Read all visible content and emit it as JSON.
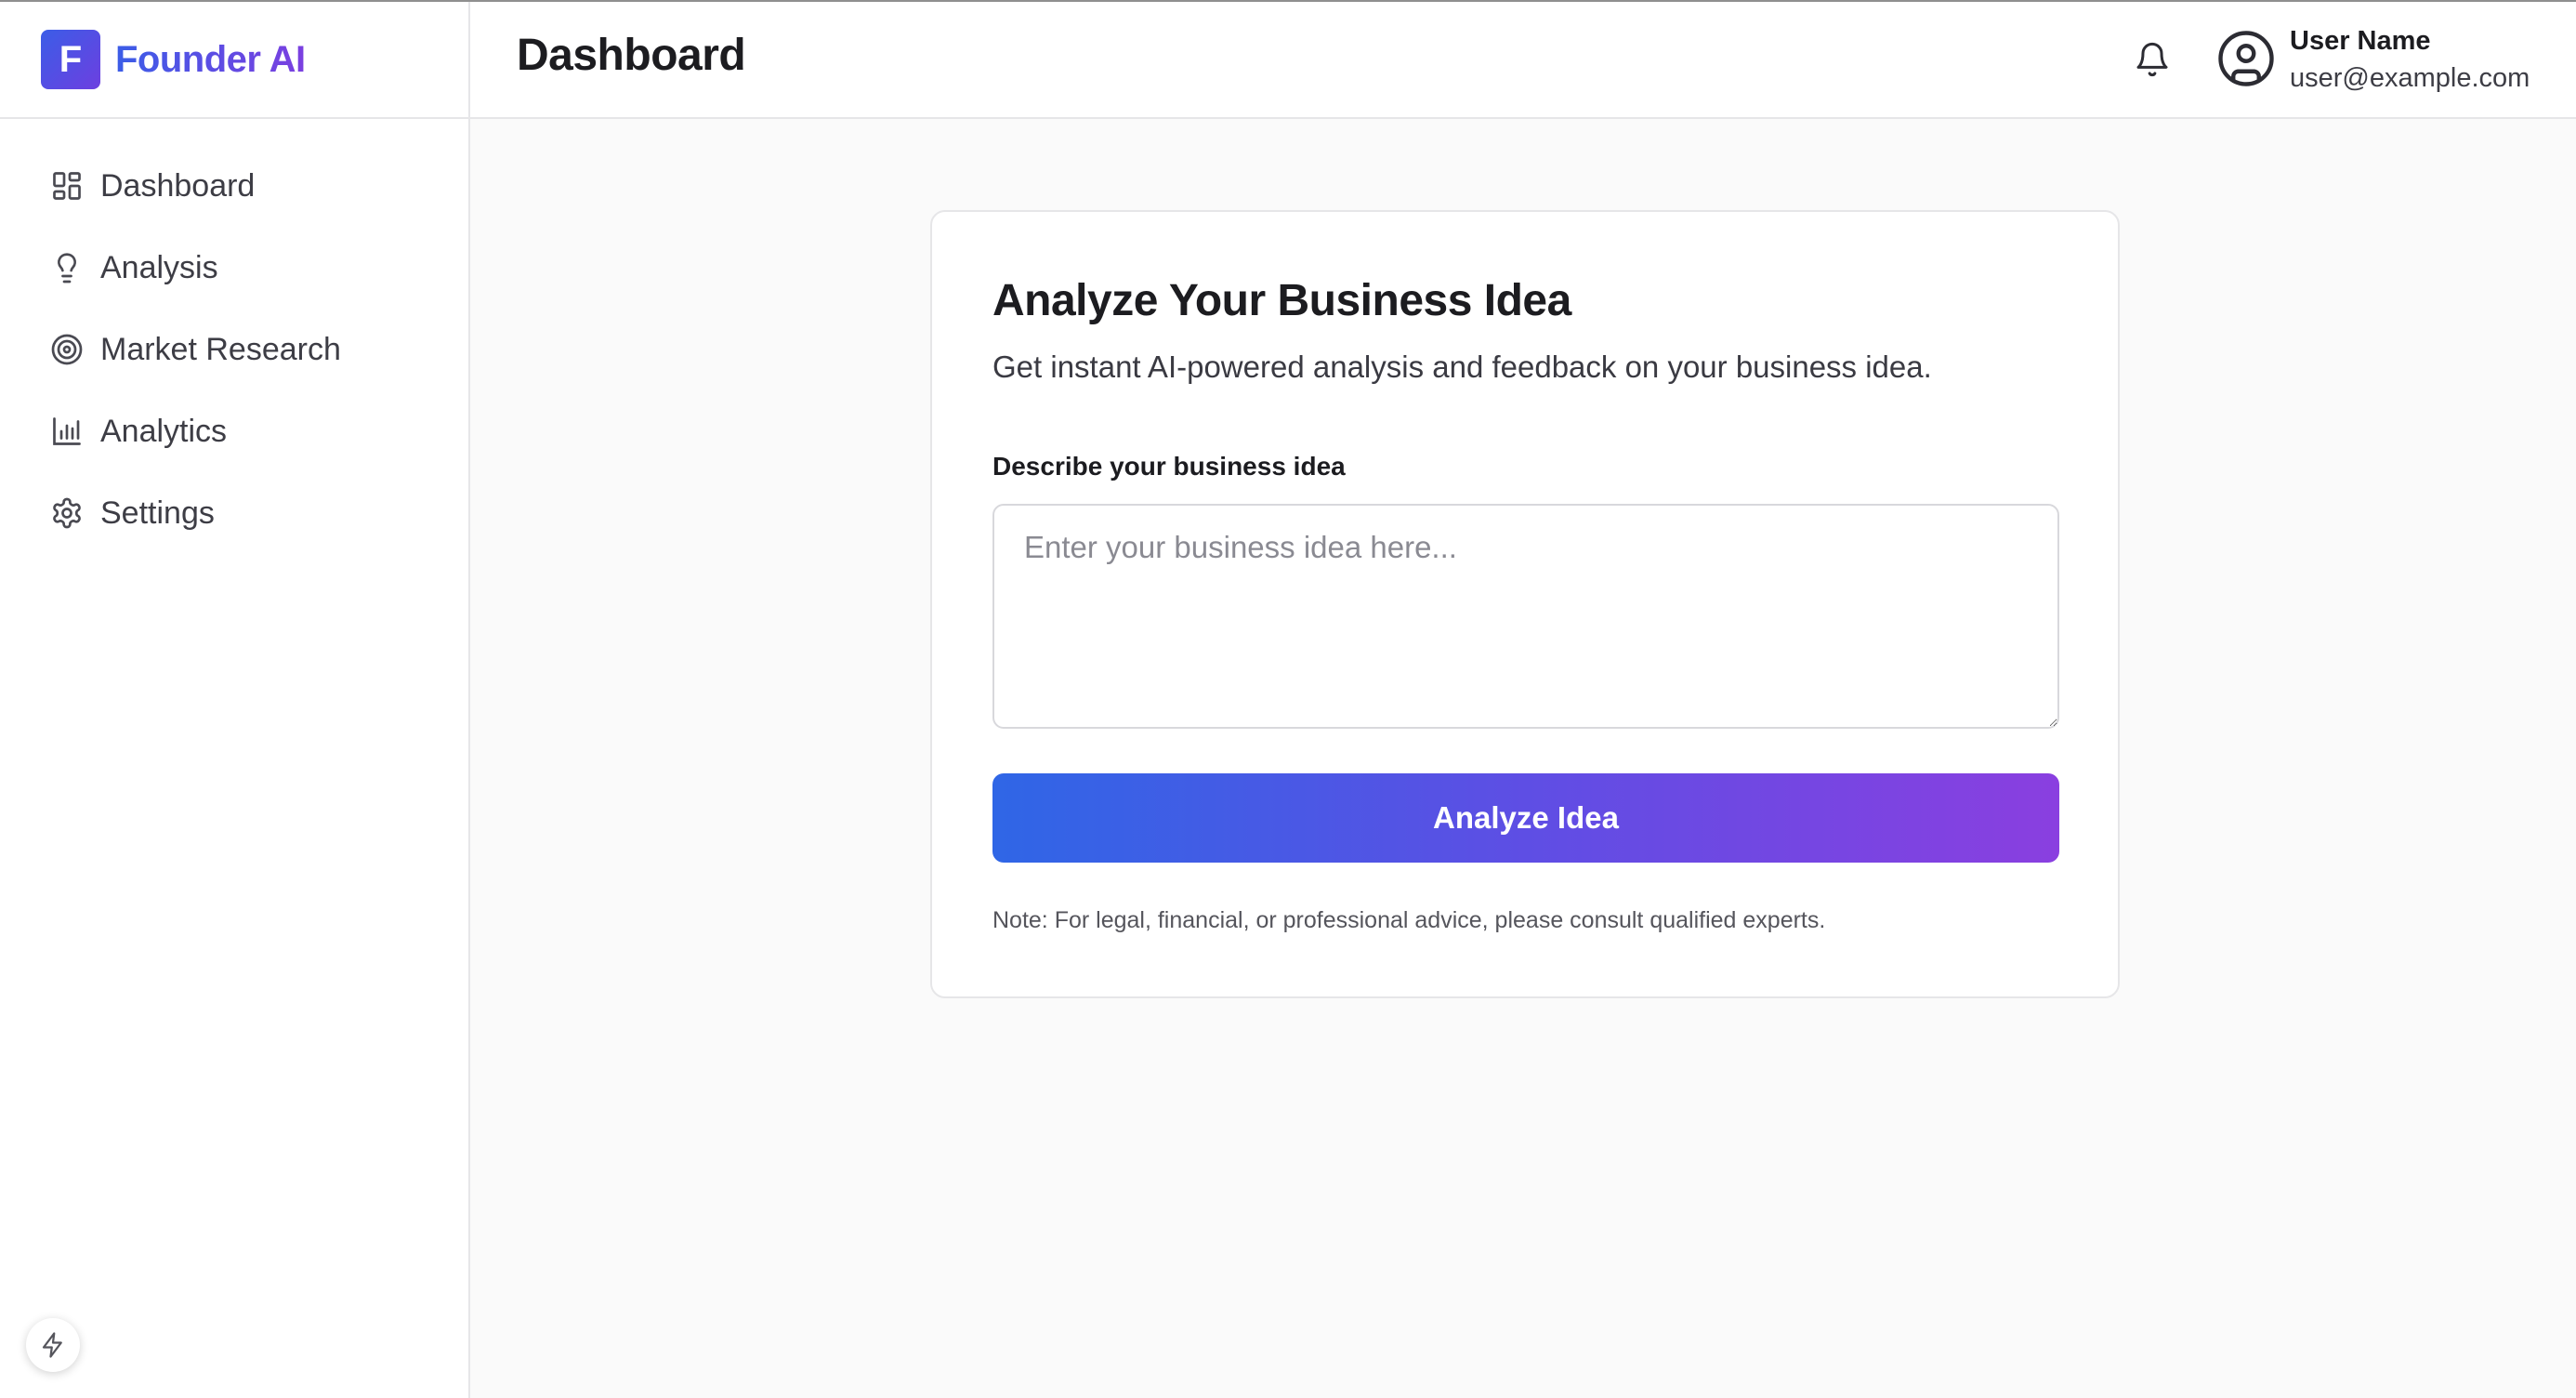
{
  "app": {
    "logo_letter": "F",
    "name": "Founder AI"
  },
  "sidebar": {
    "items": [
      {
        "label": "Dashboard",
        "icon": "grid-icon"
      },
      {
        "label": "Analysis",
        "icon": "lightbulb-icon"
      },
      {
        "label": "Market Research",
        "icon": "target-icon"
      },
      {
        "label": "Analytics",
        "icon": "bar-chart-icon"
      },
      {
        "label": "Settings",
        "icon": "gear-icon"
      }
    ]
  },
  "header": {
    "title": "Dashboard",
    "user_name": "User Name",
    "user_email": "user@example.com"
  },
  "card": {
    "title": "Analyze Your Business Idea",
    "subtitle": "Get instant AI-powered analysis and feedback on your business idea.",
    "field_label": "Describe your business idea",
    "input_placeholder": "Enter your business idea here...",
    "input_value": "",
    "button_label": "Analyze Idea",
    "note": "Note: For legal, financial, or professional advice, please consult qualified experts."
  },
  "colors": {
    "accent_start": "#2f66e6",
    "accent_end": "#8a3fe0",
    "background": "#fafafa"
  }
}
